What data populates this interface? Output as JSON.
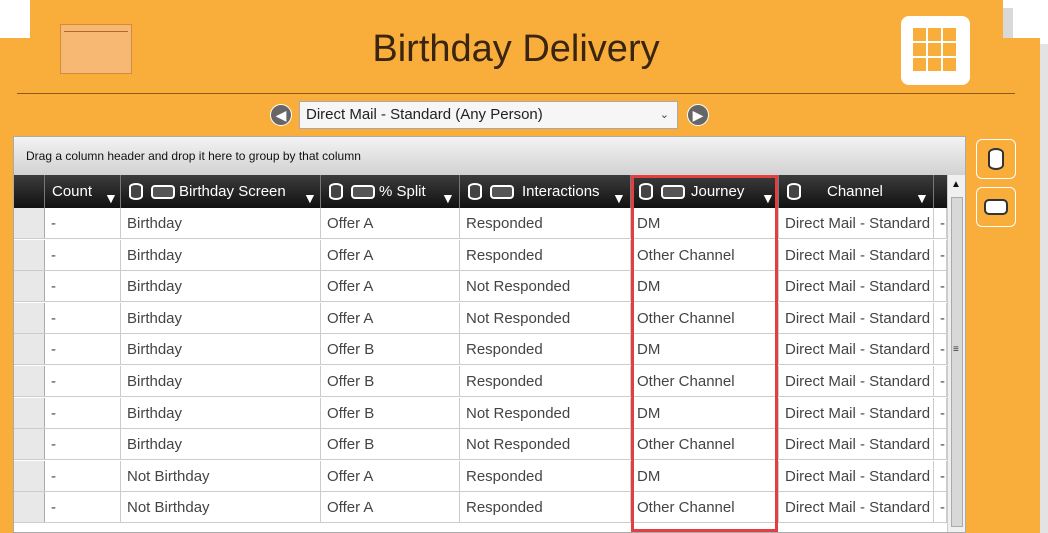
{
  "header": {
    "title": "Birthday Delivery",
    "apps_icon": "grid-apps-icon",
    "folder_icon": "folder-icon"
  },
  "selector": {
    "prev_icon": "arrow-left-icon",
    "next_icon": "arrow-right-icon",
    "value": "Direct Mail - Standard (Any Person)",
    "dropdown_icon": "chevron-down-icon"
  },
  "grid": {
    "group_hint": "Drag a column header and drop it here to group by that column",
    "columns": [
      {
        "label": "Count"
      },
      {
        "label": "Birthday Screen"
      },
      {
        "label": "% Split"
      },
      {
        "label": "Interactions"
      },
      {
        "label": "Journey"
      },
      {
        "label": "Channel"
      }
    ],
    "rows": [
      [
        "-",
        "Birthday",
        "Offer A",
        "Responded",
        "DM",
        "Direct Mail - Standard",
        "-"
      ],
      [
        "-",
        "Birthday",
        "Offer A",
        "Responded",
        "Other Channel",
        "Direct Mail - Standard",
        "-"
      ],
      [
        "-",
        "Birthday",
        "Offer A",
        "Not Responded",
        "DM",
        "Direct Mail - Standard",
        "-"
      ],
      [
        "-",
        "Birthday",
        "Offer A",
        "Not Responded",
        "Other Channel",
        "Direct Mail - Standard",
        "-"
      ],
      [
        "-",
        "Birthday",
        "Offer B",
        "Responded",
        "DM",
        "Direct Mail - Standard",
        "-"
      ],
      [
        "-",
        "Birthday",
        "Offer B",
        "Responded",
        "Other Channel",
        "Direct Mail - Standard",
        "-"
      ],
      [
        "-",
        "Birthday",
        "Offer B",
        "Not Responded",
        "DM",
        "Direct Mail - Standard",
        "-"
      ],
      [
        "-",
        "Birthday",
        "Offer B",
        "Not Responded",
        "Other Channel",
        "Direct Mail - Standard",
        "-"
      ],
      [
        "-",
        "Not Birthday",
        "Offer A",
        "Responded",
        "DM",
        "Direct Mail - Standard",
        "-"
      ],
      [
        "-",
        "Not Birthday",
        "Offer A",
        "Responded",
        "Other Channel",
        "Direct Mail - Standard",
        "-"
      ]
    ]
  },
  "side_buttons": [
    {
      "icon": "database-icon"
    },
    {
      "icon": "decision-shape-icon"
    }
  ],
  "colors": {
    "accent": "#f9ad3b",
    "highlight": "#e24040",
    "header_dark": "#111111"
  }
}
